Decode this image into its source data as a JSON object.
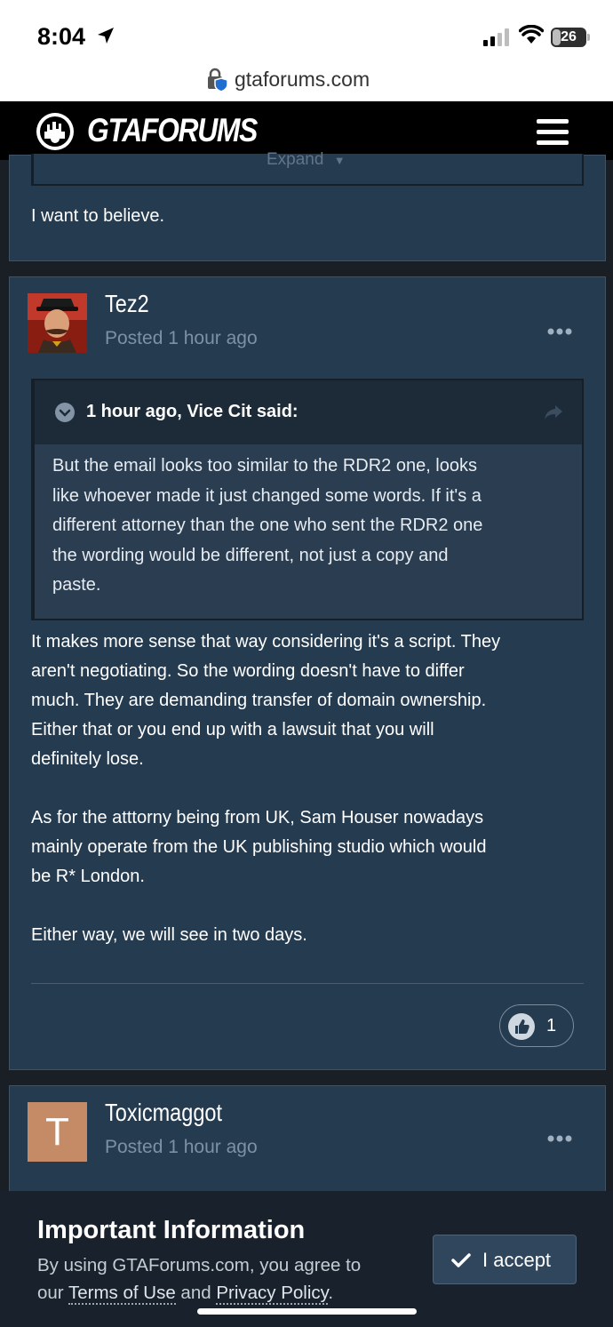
{
  "status_bar": {
    "time": "8:04",
    "battery": "26",
    "battery_level": 0.26
  },
  "browser": {
    "url": "gtaforums.com"
  },
  "header": {
    "logo_text": "GTAFORUMS"
  },
  "previous_post": {
    "expand_label": "Expand",
    "text": "I want to believe."
  },
  "post": {
    "username": "Tez2",
    "posted": "Posted 1 hour ago",
    "quote": {
      "cite": "1 hour ago, Vice Cit said:",
      "lines": [
        "But the email looks too similar to the RDR2 one, looks",
        "like whoever made it just changed some words. If it's a",
        "different attorney than the one who sent the RDR2 one",
        "the wording would be different, not just a copy and",
        "paste."
      ]
    },
    "paragraph1": [
      "It makes more sense that way considering it's a script. They",
      "aren't negotiating. So the wording doesn't have to differ",
      "much. They are demanding transfer of domain ownership.",
      "Either that or you end up with a lawsuit that you will",
      "definitely lose."
    ],
    "paragraph2": [
      "As for the atttorny being from UK, Sam Houser nowadays",
      "mainly operate from the UK publishing studio which would",
      "be R* London."
    ],
    "paragraph3": "Either way, we will see in two days.",
    "reaction_count": "1"
  },
  "next_post": {
    "avatar_letter": "T",
    "username": "Toxicmaggot",
    "posted": "Posted 1 hour ago"
  },
  "cookie_banner": {
    "title": "Important Information",
    "text_line1": "By using GTAForums.com, you agree to",
    "text_prefix": "our ",
    "terms_link": "Terms of Use",
    "and_text": " and ",
    "privacy_link": "Privacy Policy",
    "text_suffix": ".",
    "accept_label": "I accept"
  },
  "colors": {
    "card_bg": "#253b50",
    "page_bg": "#1a1f26",
    "avatar_bg": "#c58b66"
  }
}
